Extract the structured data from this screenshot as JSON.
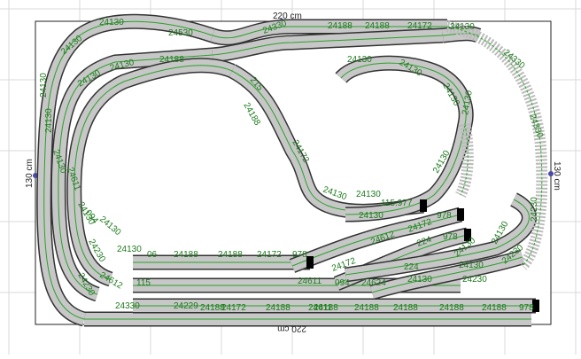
{
  "dimensions": {
    "top": "220 cm",
    "bottom": "220 cm",
    "left": "130 cm",
    "right": "130 cm"
  },
  "track_labels": [
    {
      "id": "l1",
      "text": "24130",
      "rot": -40
    },
    {
      "id": "l2",
      "text": "24130",
      "rot": 0
    },
    {
      "id": "l3",
      "text": "24530",
      "rot": 0
    },
    {
      "id": "l4",
      "text": "24330",
      "rot": -20
    },
    {
      "id": "l5",
      "text": "24188",
      "rot": 0
    },
    {
      "id": "l6",
      "text": "24188",
      "rot": 0
    },
    {
      "id": "l7",
      "text": "24172",
      "rot": 0
    },
    {
      "id": "l8",
      "text": "24130",
      "rot": 0
    },
    {
      "id": "l9",
      "text": "24130",
      "rot": -15
    },
    {
      "id": "l10",
      "text": "24188",
      "rot": 0
    },
    {
      "id": "l11",
      "text": "24130",
      "rot": -90
    },
    {
      "id": "l12",
      "text": "24130",
      "rot": -30
    },
    {
      "id": "l13",
      "text": "24130",
      "rot": 0
    },
    {
      "id": "l14",
      "text": "24130",
      "rot": 30
    },
    {
      "id": "l15",
      "text": "24130",
      "rot": 60
    },
    {
      "id": "l16",
      "text": "24330",
      "rot": 40
    },
    {
      "id": "l17",
      "text": "24330",
      "rot": 70
    },
    {
      "id": "l18",
      "text": "24130",
      "rot": -90
    },
    {
      "id": "l19",
      "text": "24188",
      "rot": 60
    },
    {
      "id": "l20",
      "text": "24172",
      "rot": 60
    },
    {
      "id": "l21",
      "text": "215",
      "rot": 50
    },
    {
      "id": "l22",
      "text": "24130",
      "rot": 20
    },
    {
      "id": "l23",
      "text": "24130",
      "rot": 0
    },
    {
      "id": "l24",
      "text": "115.977",
      "rot": 0
    },
    {
      "id": "l25",
      "text": "24130",
      "rot": -60
    },
    {
      "id": "l26",
      "text": "24130",
      "rot": -80
    },
    {
      "id": "l27",
      "text": "24230",
      "rot": -90
    },
    {
      "id": "l28",
      "text": "24130",
      "rot": 0
    },
    {
      "id": "l29",
      "text": "978",
      "rot": 0
    },
    {
      "id": "l30",
      "text": "24612",
      "rot": -20
    },
    {
      "id": "l31",
      "text": "24172",
      "rot": -20
    },
    {
      "id": "l32",
      "text": "224",
      "rot": -20
    },
    {
      "id": "l33",
      "text": "978",
      "rot": 0
    },
    {
      "id": "l34",
      "text": "24130",
      "rot": -40
    },
    {
      "id": "l35",
      "text": "24130",
      "rot": 0
    },
    {
      "id": "l36",
      "text": "24130",
      "rot": -60
    },
    {
      "id": "l37",
      "text": "24230",
      "rot": -40
    },
    {
      "id": "l38",
      "text": "24188",
      "rot": 0
    },
    {
      "id": "l39",
      "text": "24188",
      "rot": 0
    },
    {
      "id": "l40",
      "text": "24172",
      "rot": 0
    },
    {
      "id": "l41",
      "text": "978",
      "rot": 0
    },
    {
      "id": "l42",
      "text": "24172",
      "rot": -20
    },
    {
      "id": "l43",
      "text": "224",
      "rot": 0
    },
    {
      "id": "l44",
      "text": "24611",
      "rot": 0
    },
    {
      "id": "l45",
      "text": "094",
      "rot": 0
    },
    {
      "id": "l46",
      "text": "24624",
      "rot": 0
    },
    {
      "id": "l47",
      "text": "24130",
      "rot": 0
    },
    {
      "id": "l48",
      "text": "24230",
      "rot": 0
    },
    {
      "id": "l49",
      "text": "24188",
      "rot": 0
    },
    {
      "id": "l50",
      "text": "24188",
      "rot": 0
    },
    {
      "id": "l51",
      "text": "24188",
      "rot": 0
    },
    {
      "id": "l52",
      "text": "24188",
      "rot": 0
    },
    {
      "id": "l53",
      "text": "24188",
      "rot": 0
    },
    {
      "id": "l54",
      "text": "978",
      "rot": 0
    },
    {
      "id": "l55",
      "text": "24330",
      "rot": 0
    },
    {
      "id": "l56",
      "text": "24229",
      "rot": 0
    },
    {
      "id": "l57",
      "text": "24172",
      "rot": 0
    },
    {
      "id": "l58",
      "text": "24188",
      "rot": 0
    },
    {
      "id": "l59",
      "text": "24611",
      "rot": 0
    },
    {
      "id": "l60",
      "text": "24130",
      "rot": 70
    },
    {
      "id": "l61",
      "text": "24611",
      "rot": 70
    },
    {
      "id": "l62",
      "text": "24130",
      "rot": 60
    },
    {
      "id": "l63",
      "text": "094",
      "rot": 50
    },
    {
      "id": "l64",
      "text": "24230",
      "rot": 60
    },
    {
      "id": "l65",
      "text": "24130",
      "rot": 40
    },
    {
      "id": "l66",
      "text": "24612",
      "rot": 30
    },
    {
      "id": "l67",
      "text": "24230",
      "rot": 60
    },
    {
      "id": "l68",
      "text": "115",
      "rot": 0
    },
    {
      "id": "l69",
      "text": "24130",
      "rot": 0
    },
    {
      "id": "l70",
      "text": "06",
      "rot": 0
    },
    {
      "id": "l71",
      "text": "24188",
      "rot": 0
    }
  ]
}
